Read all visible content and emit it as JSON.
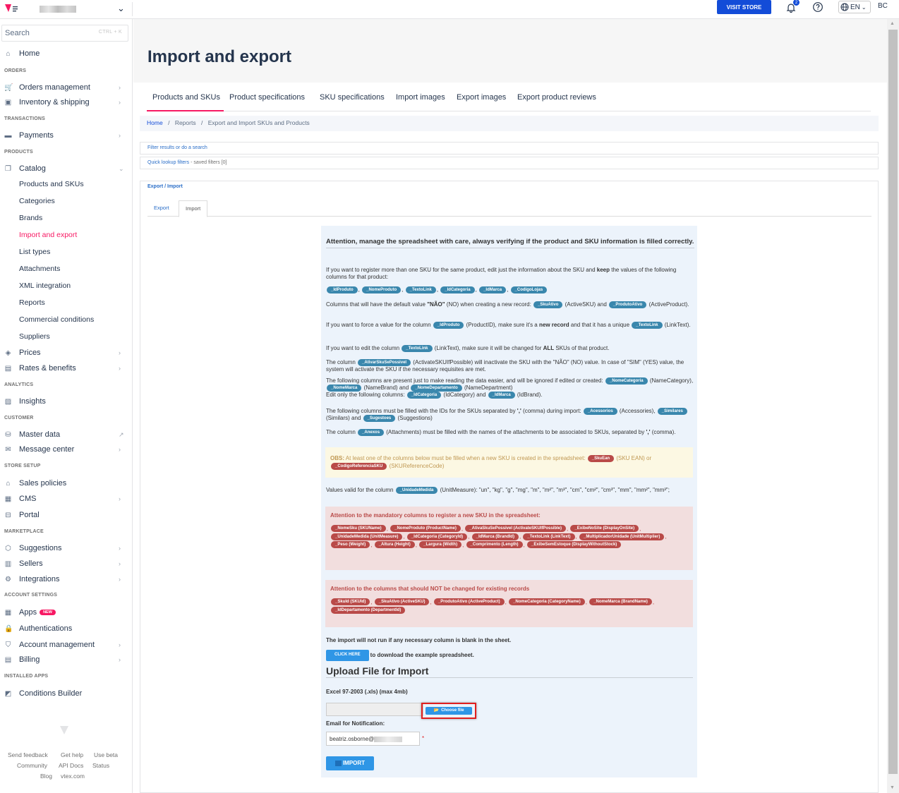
{
  "topbar": {
    "visit_store": "VISIT STORE",
    "notification_count": "2",
    "language": "EN",
    "user_initials": "BC"
  },
  "sidebar": {
    "search_placeholder": "Search",
    "search_shortcut": "CTRL + K",
    "home": "Home",
    "sections": {
      "orders": "ORDERS",
      "transactions": "TRANSACTIONS",
      "products": "PRODUCTS",
      "analytics": "ANALYTICS",
      "customer": "CUSTOMER",
      "store_setup": "STORE SETUP",
      "marketplace": "MARKETPLACE",
      "account_settings": "ACCOUNT SETTINGS",
      "installed_apps": "INSTALLED APPS"
    },
    "items": {
      "orders_management": "Orders management",
      "inventory": "Inventory & shipping",
      "payments": "Payments",
      "catalog": "Catalog",
      "prices": "Prices",
      "rates": "Rates & benefits",
      "insights": "Insights",
      "master_data": "Master data",
      "message_center": "Message center",
      "sales_policies": "Sales policies",
      "cms": "CMS",
      "portal": "Portal",
      "suggestions": "Suggestions",
      "sellers": "Sellers",
      "integrations": "Integrations",
      "apps": "Apps",
      "apps_badge": "NEW",
      "authentications": "Authentications",
      "account_management": "Account management",
      "billing": "Billing",
      "conditions_builder": "Conditions Builder"
    },
    "catalog_sub": [
      "Products and SKUs",
      "Categories",
      "Brands",
      "Import and export",
      "List types",
      "Attachments",
      "XML integration",
      "Reports",
      "Commercial conditions",
      "Suppliers"
    ],
    "footer": {
      "send_feedback": "Send feedback",
      "get_help": "Get help",
      "use_beta": "Use beta",
      "community": "Community",
      "api_docs": "API Docs",
      "status": "Status",
      "blog": "Blog",
      "vtex": "vtex.com"
    }
  },
  "page": {
    "title": "Import and export",
    "tabs": [
      "Products and SKUs",
      "Product specifications",
      "SKU specifications",
      "Import images",
      "Export images",
      "Export product reviews"
    ],
    "breadcrumb": {
      "home": "Home",
      "reports": "Reports",
      "current": "Export and Import SKUs and Products"
    },
    "filter_text": "Filter results or do a search",
    "quick_lookup": "Quick lookup filters",
    "saved_filters": " - saved filters [0]",
    "ei_title": "Export / Import",
    "ei_tabs": {
      "export": "Export",
      "import": "Import"
    }
  },
  "info": {
    "attention": "Attention, manage the spreadsheet with care, always verifying if the product and SKU information is filled correctly.",
    "p1a": "If you want to register more than one SKU for the same product, edit just the information about the SKU and ",
    "p1b": "keep",
    "p1c": " the values of the following columns for that product:",
    "pills1": [
      "_IdProduto",
      "_NomeProduto",
      "_TextoLink",
      "_IdCategoria",
      "_IdMarca",
      "_CodigoLojas"
    ],
    "p2a": "Columns that will have the default value ",
    "p2b": "\"NÃO\"",
    "p2c": " (NO) when creating a new record: ",
    "p2pill1": "_SkuAtivo",
    "p2d": " (ActiveSKU) and ",
    "p2pill2": "_ProdutoAtivo",
    "p2e": " (ActiveProduct).",
    "p3a": "If you want to force a value for the column ",
    "p3pill": "_IdProduto",
    "p3b": " (ProductID), make sure it's a ",
    "p3c": "new record",
    "p3d": " and that it has a unique ",
    "p3pill2": "_TextoLink",
    "p3e": " (LinkText).",
    "p4a": "If you want to edit the column ",
    "p4pill": "_TextoLink",
    "p4b": " (LinkText), make sure it will be changed for ",
    "p4c": "ALL",
    "p4d": " SKUs of that product.",
    "p5a": "The column ",
    "p5pill": "_AtivarSkuSePossivel",
    "p5b": " (ActivateSKUIfPossible) will inactivate the SKU with the \"NÃO\" (NO) value. In case of \"SIM\" (YES) value, the system will activate the SKU if the necessary requisites are met.",
    "p6a": "The following columns are present just to make reading the data easier, and will be ignored if edited or created: ",
    "p6pill1": "_NomeCategoria",
    "p6b": " (NameCategory), ",
    "p6pill2": "_NomeMarca",
    "p6c": " (NameBrand) and ",
    "p6pill3": "_NomeDepartamento",
    "p6d": " (NameDepartment)",
    "p6e": "Edit only the following columns: ",
    "p6pill4": "_IdCategoria",
    "p6f": " (IdCategory) and ",
    "p6pill5": "_IdMarca",
    "p6g": " (IdBrand).",
    "p7a": "The following columns must be filled with the IDs for the SKUs separated by ",
    "p7b": "','",
    "p7c": " (comma) during import: ",
    "p7pill1": "_Acessorios",
    "p7d": " (Accessories), ",
    "p7pill2": "_Similares",
    "p7e": " (Similars) and ",
    "p7pill3": "_Sugestoes",
    "p7f": " (Suggestions)",
    "p8a": "The column ",
    "p8pill": "_Anexos",
    "p8b": " (Attachments) must be filled with the names of the attachments to be associated to SKUs, separated by ",
    "p8c": "','",
    "p8d": " (comma).",
    "obs_label": "OBS:",
    "obs_text": " At least one of the columns below must be filled when a new SKU is created in the spreadsheet: ",
    "obs_pill1": "_SkuEan",
    "obs_b": " (SKU EAN) or ",
    "obs_pill2": "_CodigoReferenciaSKU",
    "obs_c": " (SKUReferenceCode)",
    "p9a": "Values valid for the column ",
    "p9pill": "_UnidadeMedida",
    "p9b": " (UnitMeasure): \"un\", \"kg\", \"g\", \"mg\", \"m\", \"m²\", \"m³\", \"cm\", \"cm²\", \"cm³\", \"mm\", \"mm²\", \"mm³\";",
    "mandatory_title": "Attention to the mandatory columns to register a new SKU in the spreadsheet:",
    "mandatory_pills": [
      "_NomeSku (SKUName)",
      "_NomeProduto (ProductName)",
      "_AtivaSkuSePossivel (ActivateSKUIfPossible)",
      "_ExibeNoSite (DisplayOnSite)",
      "_UnidadeMedida (UnitMeasure)",
      "_IdCategoria (CategoryId)",
      "_IdMarca (BrandId)",
      "_TextoLink (LinkText)",
      "_MultiplicadorUnidade (UnitMultiplier)",
      "_Peso (Weight)",
      "_Altura (Height)",
      "_Largura (Width)",
      "_Comprimento (Length)",
      "_ExibeSemEstoque (DisplayWithoutStock)"
    ],
    "nochange_title": "Attention to the columns that should NOT be changed for existing records",
    "nochange_pills": [
      "_SkuId (SKUId)",
      "_SkuAtivo (ActiveSKU)",
      "_ProdutoAtivo (ActiveProduct)",
      "_NomeCategoria (CategoryName)",
      "_NomeMarca (BrandName)",
      "_IdDepartamento (DepartmentId)"
    ],
    "blank_warning": "The import will not run if any necessary column is blank in the sheet.",
    "click_here": "CLICK HERE",
    "download_text": "to download the example spreadsheet.",
    "upload_title": "Upload File for Import",
    "excel_label": "Excel 97-2003 (.xls) (max 4mb)",
    "choose_file": "Choose file",
    "email_label": "Email for Notification:",
    "email_value": "beatriz.osborne@",
    "required_mark": "*",
    "import_button": "IMPORT"
  }
}
